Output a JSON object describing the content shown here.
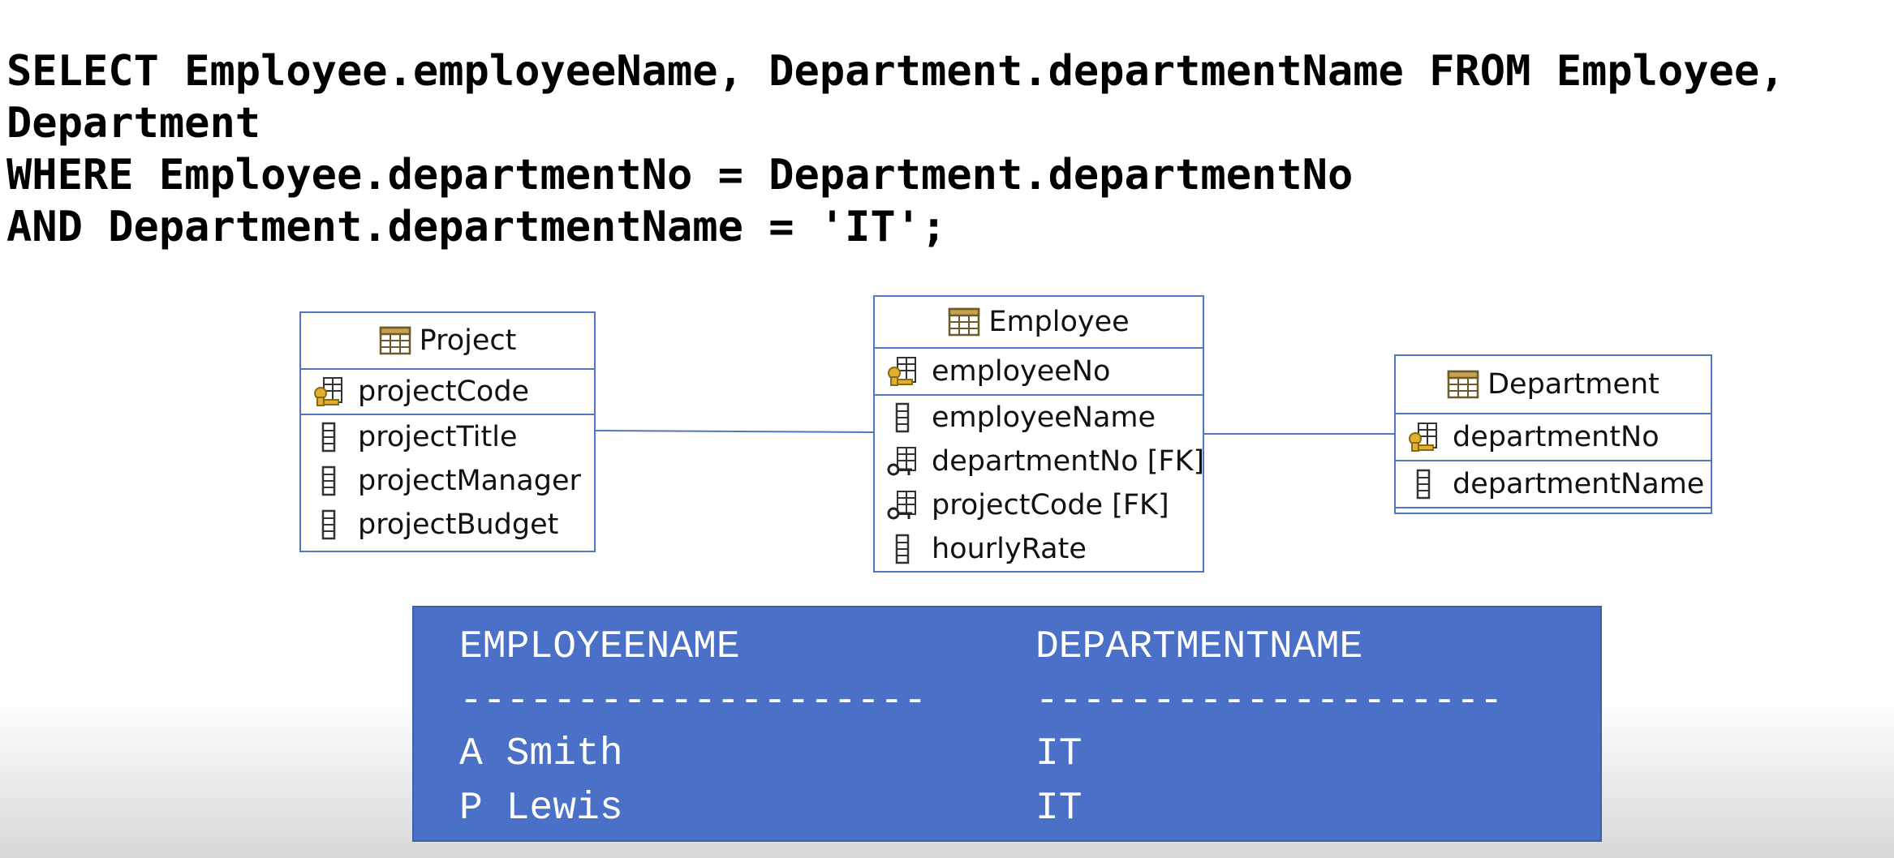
{
  "sql": {
    "lines": [
      "SELECT Employee.employeeName, Department.departmentName FROM Employee,",
      "Department",
      "WHERE Employee.departmentNo = Department.departmentNo",
      "AND Department.departmentName = 'IT';"
    ]
  },
  "diagram": {
    "entities": {
      "project": {
        "title": "Project",
        "pk": "projectCode",
        "fields": [
          "projectTitle",
          "projectManager",
          "projectBudget"
        ]
      },
      "employee": {
        "title": "Employee",
        "pk": "employeeNo",
        "fields": [
          "employeeName",
          "departmentNo [FK]",
          "projectCode [FK]",
          "hourlyRate"
        ]
      },
      "department": {
        "title": "Department",
        "pk": "departmentNo",
        "fields": [
          "departmentName"
        ]
      }
    },
    "colors": {
      "border": "#4e78c4",
      "connector": "#4e78c4"
    }
  },
  "result": {
    "headers": [
      "EMPLOYEENAME",
      "DEPARTMENTNAME"
    ],
    "separators": [
      "--------------------",
      "--------------------"
    ],
    "rows": [
      [
        "A Smith",
        "IT"
      ],
      [
        "P Lewis",
        "IT"
      ]
    ],
    "colors": {
      "background": "#4a70c8",
      "text": "#ffffff"
    }
  }
}
